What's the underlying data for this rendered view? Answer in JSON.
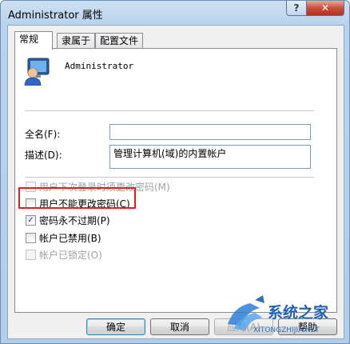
{
  "window": {
    "title": "Administrator 属性",
    "help_glyph": "?",
    "close_glyph": "✕"
  },
  "tabs": [
    {
      "label": "常规",
      "active": true
    },
    {
      "label": "隶属于",
      "active": false
    },
    {
      "label": "配置文件",
      "active": false
    }
  ],
  "general": {
    "user_name": "Administrator",
    "full_name_label": "全名(F):",
    "full_name_value": "",
    "description_label": "描述(D):",
    "description_value": "管理计算机(域)的内置帐户"
  },
  "checkboxes": [
    {
      "label": "用户下次登录时须更改密码(M)",
      "checked": false,
      "enabled": false
    },
    {
      "label": "用户不能更改密码(C)",
      "checked": false,
      "enabled": true
    },
    {
      "label": "密码永不过期(P)",
      "checked": true,
      "enabled": true
    },
    {
      "label": "帐户已禁用(B)",
      "checked": false,
      "enabled": true
    },
    {
      "label": "帐户已锁定(O)",
      "checked": false,
      "enabled": false
    }
  ],
  "buttons": {
    "ok": "确定",
    "cancel": "取消",
    "apply": "应用(A)",
    "help": "帮助"
  },
  "watermark": {
    "text": "系统之家",
    "url": "XITONGZHIJIA.NET"
  },
  "colors": {
    "highlight": "#e21d1d",
    "title_bar": "#bad3ed",
    "close_button": "#c7503b"
  }
}
